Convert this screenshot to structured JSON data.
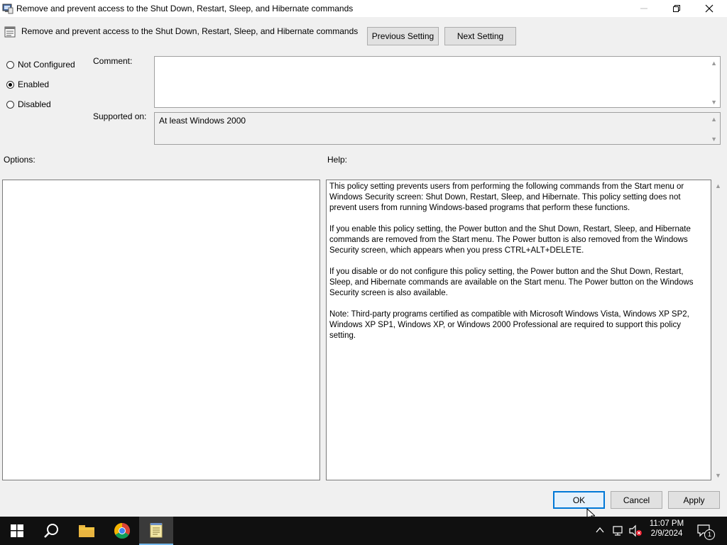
{
  "window": {
    "title": "Remove and prevent access to the Shut Down, Restart, Sleep, and Hibernate commands"
  },
  "header": {
    "policy_title": "Remove and prevent access to the Shut Down, Restart, Sleep, and Hibernate commands",
    "previous_label": "Previous Setting",
    "next_label": "Next Setting"
  },
  "state": {
    "options": [
      "Not Configured",
      "Enabled",
      "Disabled"
    ],
    "selected": "Enabled"
  },
  "comment": {
    "label": "Comment:",
    "value": ""
  },
  "supported": {
    "label": "Supported on:",
    "value": "At least Windows 2000"
  },
  "options_panel": {
    "label": "Options:"
  },
  "help": {
    "label": "Help:",
    "paragraphs": [
      "This policy setting prevents users from performing the following commands from the Start menu or Windows Security screen: Shut Down, Restart, Sleep, and Hibernate. This policy setting does not prevent users from running Windows-based programs that perform these functions.",
      "If you enable this policy setting, the Power button and the Shut Down, Restart, Sleep, and Hibernate commands are removed from the Start menu. The Power button is also removed from the Windows Security screen, which appears when you press CTRL+ALT+DELETE.",
      "If you disable or do not configure this policy setting, the Power button and the Shut Down, Restart, Sleep, and Hibernate commands are available on the Start menu. The Power button on the Windows Security screen is also available.",
      "Note: Third-party programs certified as compatible with Microsoft Windows Vista, Windows XP SP2, Windows XP SP1, Windows XP, or Windows 2000 Professional are required to support this policy setting."
    ]
  },
  "footer": {
    "ok": "OK",
    "cancel": "Cancel",
    "apply": "Apply"
  },
  "taskbar": {
    "time": "11:07 PM",
    "date": "2/9/2024",
    "notification_count": "1"
  },
  "colors": {
    "accent": "#0078d7",
    "taskbar": "#101010"
  }
}
